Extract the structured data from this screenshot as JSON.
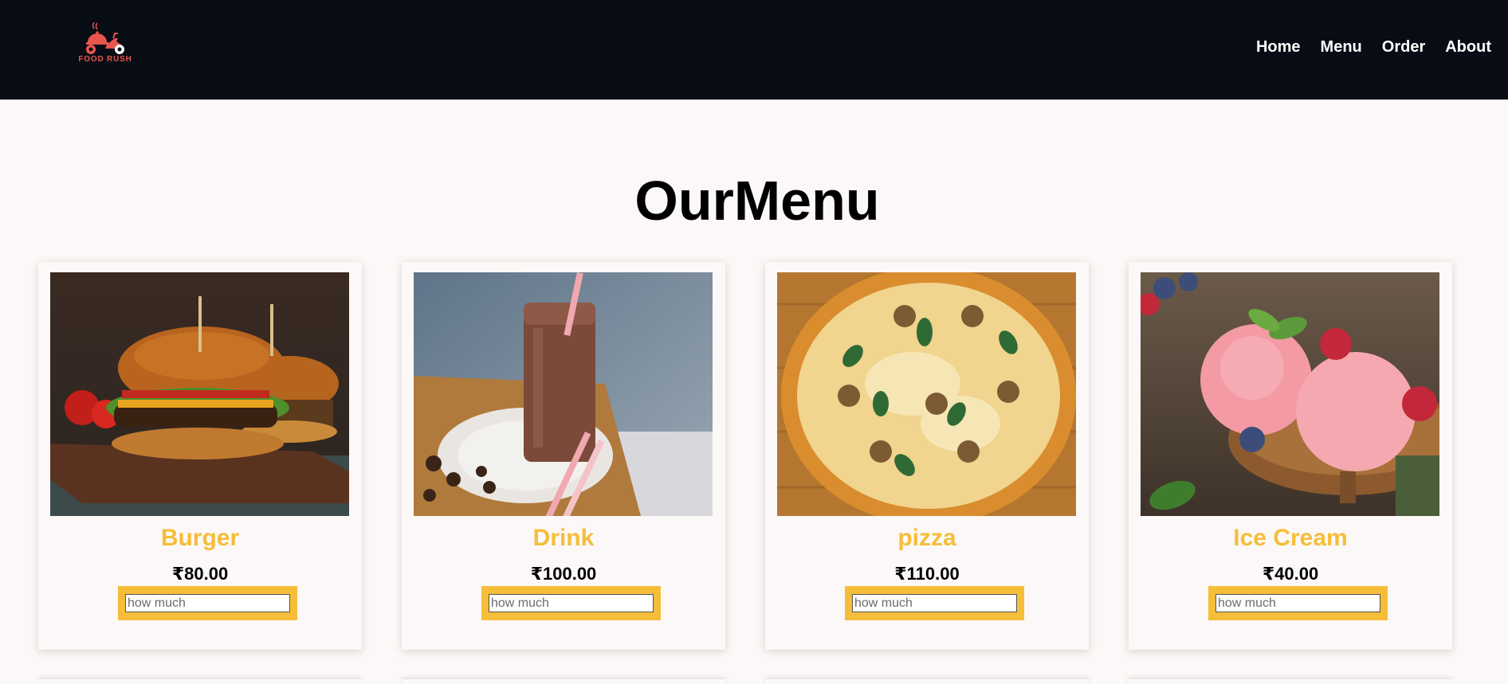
{
  "brand": {
    "name": "FOOD RUSH",
    "logo_icon": "scooter-delivery-icon",
    "accent": "#e8554e"
  },
  "nav": {
    "items": [
      {
        "label": "Home"
      },
      {
        "label": "Menu"
      },
      {
        "label": "Order"
      },
      {
        "label": "About"
      }
    ]
  },
  "menu": {
    "title": "OurMenu",
    "accent": "#f6bd39",
    "items": [
      {
        "name": "Burger",
        "price": "₹80.00",
        "qty_placeholder": "how much",
        "image": "burger-photo"
      },
      {
        "name": "Drink",
        "price": "₹100.00",
        "qty_placeholder": "how much",
        "image": "chocolate-drink-photo"
      },
      {
        "name": "pizza",
        "price": "₹110.00",
        "qty_placeholder": "how much",
        "image": "pizza-photo"
      },
      {
        "name": "Ice Cream",
        "price": "₹40.00",
        "qty_placeholder": "how much",
        "image": "ice-cream-photo"
      }
    ]
  }
}
